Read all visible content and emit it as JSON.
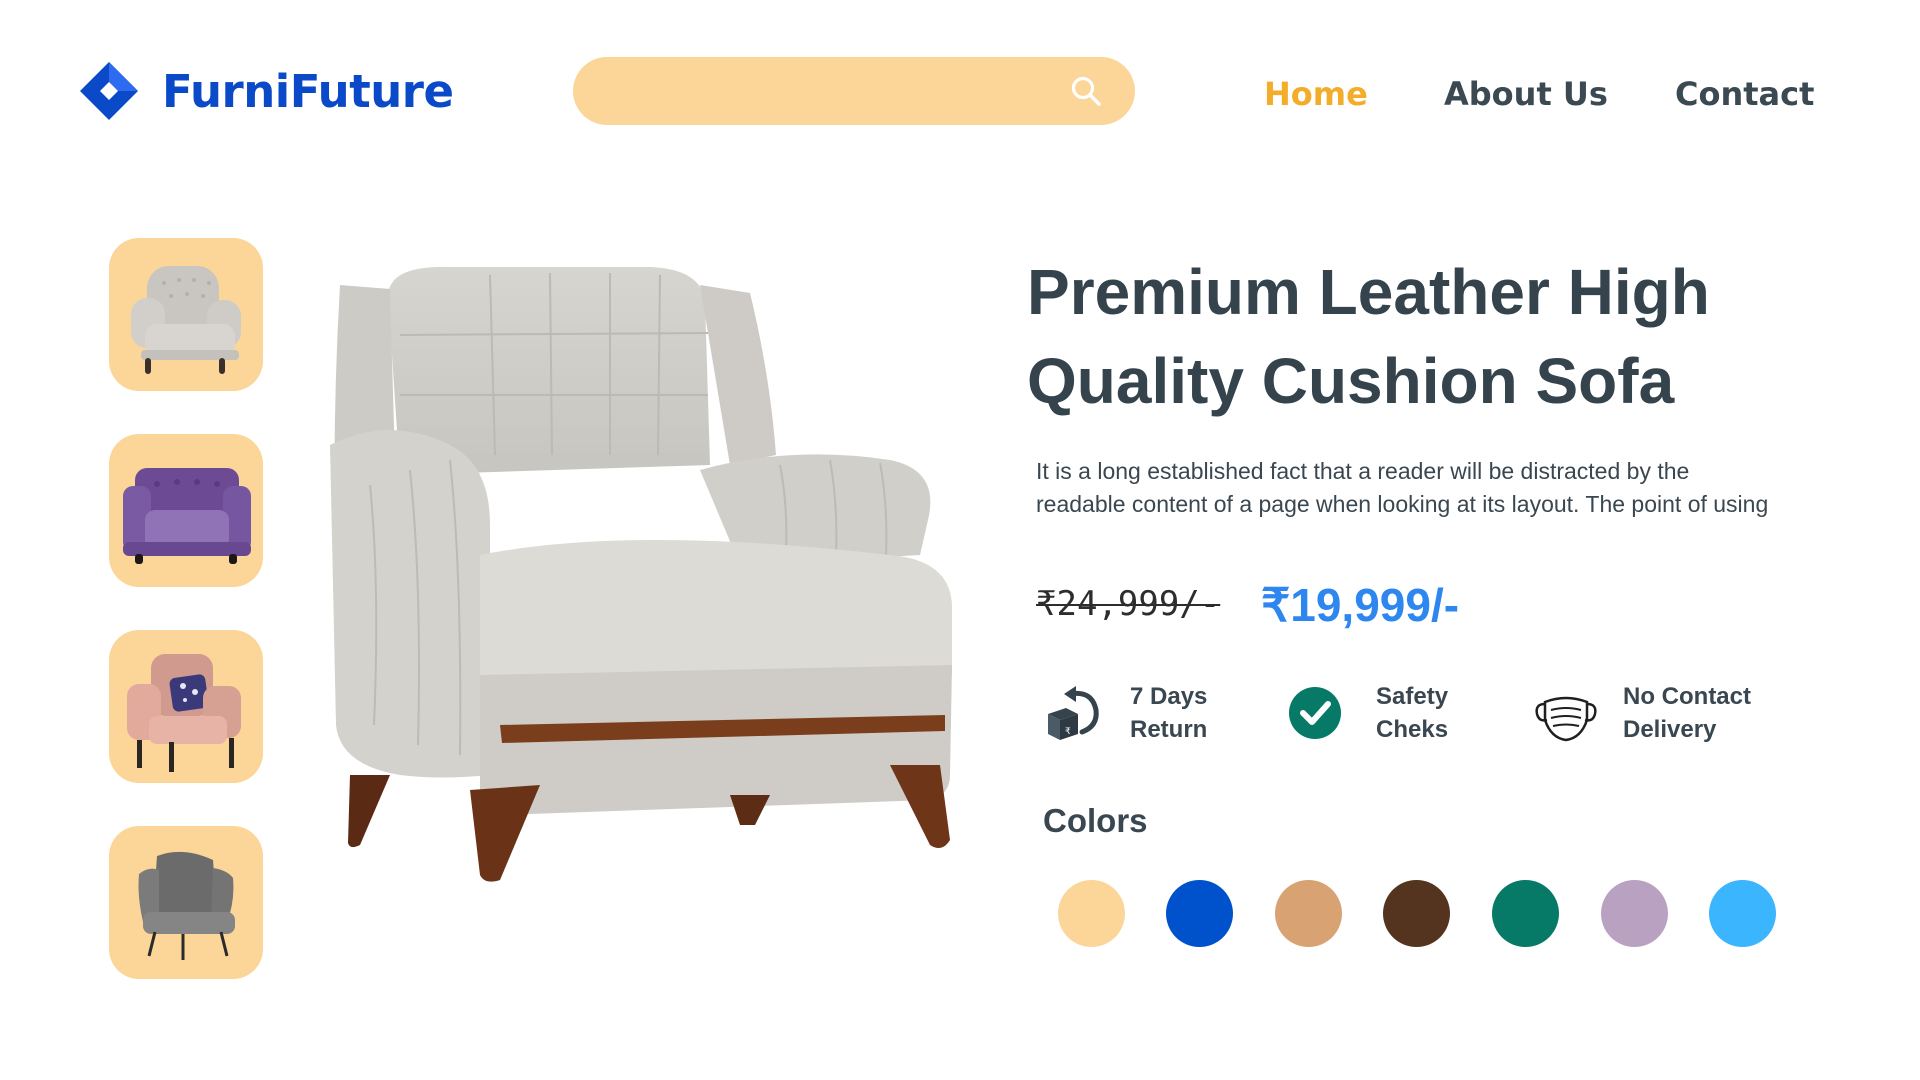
{
  "brand": {
    "name": "FurniFuture",
    "logo_icon": "diamond-logo-icon",
    "color": "#0a49c8"
  },
  "search": {
    "value": "",
    "placeholder": "",
    "icon": "search-icon",
    "background": "#fcd599"
  },
  "nav": [
    {
      "label": "Home",
      "active": true
    },
    {
      "label": "About Us",
      "active": false
    },
    {
      "label": "Contact",
      "active": false
    }
  ],
  "accent_color": "#f3ad2b",
  "thumbnails": [
    {
      "icon": "grey-tufted-armchair-thumbnail"
    },
    {
      "icon": "purple-velvet-armchair-thumbnail"
    },
    {
      "icon": "pink-leather-armchair-thumbnail"
    },
    {
      "icon": "grey-wingback-chair-thumbnail"
    }
  ],
  "main_image": {
    "icon": "beige-cushion-armchair-image"
  },
  "product": {
    "title_line1": "Premium Leather High",
    "title_line2": "Quality Cushion Sofa",
    "description": "It is a long established fact that a reader will be distracted by the readable content of a page when looking at its layout. The point of using",
    "old_price": "₹24,999/-",
    "new_price": "₹19,999/-",
    "price_color": "#2d87ef"
  },
  "features": [
    {
      "line1": "7 Days",
      "line2": "Return",
      "icon": "return-box-icon"
    },
    {
      "line1": "Safety",
      "line2": "Cheks",
      "icon": "check-circle-icon"
    },
    {
      "line1": "No Contact",
      "line2": "Delivery",
      "icon": "face-mask-icon"
    }
  ],
  "colors": {
    "heading": "Colors",
    "swatches": [
      "#fcd599",
      "#0051cc",
      "#d9a273",
      "#54331f",
      "#077a67",
      "#b9a2c1",
      "#3bb5fd"
    ]
  }
}
